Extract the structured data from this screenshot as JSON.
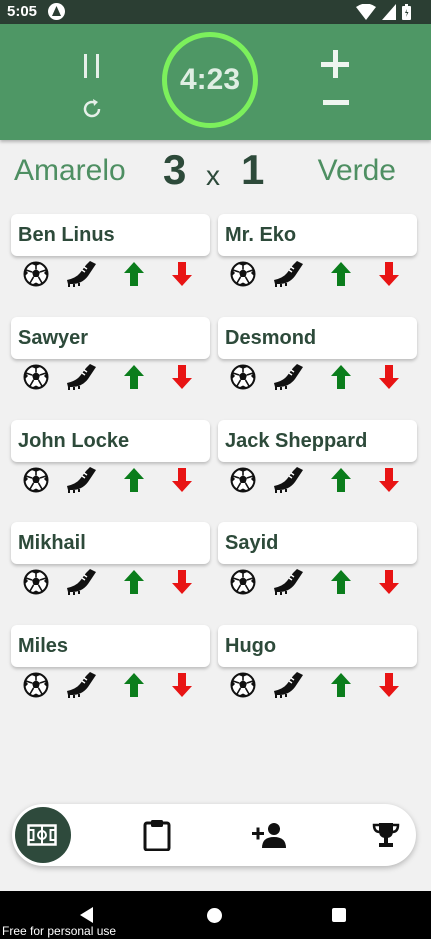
{
  "status_bar": {
    "time": "5:05"
  },
  "header": {
    "timer": "4:23",
    "colors": {
      "header_bg": "#4e9765",
      "timer_ring": "#7cf05c"
    }
  },
  "score": {
    "team_left": "Amarelo",
    "team_right": "Verde",
    "score_left": "3",
    "separator": "x",
    "score_right": "1"
  },
  "players": [
    {
      "name": "Ben Linus"
    },
    {
      "name": "Mr. Eko"
    },
    {
      "name": "Sawyer"
    },
    {
      "name": "Desmond"
    },
    {
      "name": "John Locke"
    },
    {
      "name": "Jack Sheppard"
    },
    {
      "name": "Mikhail"
    },
    {
      "name": "Sayid"
    },
    {
      "name": "Miles"
    },
    {
      "name": "Hugo"
    }
  ],
  "player_actions": [
    "soccer-ball-icon",
    "soccer-cleat-icon",
    "arrow-up-icon",
    "arrow-down-icon"
  ],
  "nav": {
    "items": [
      "field-icon",
      "clipboard-icon",
      "add-person-icon",
      "trophy-icon"
    ],
    "active": "field-icon"
  },
  "watermark": "Free for personal use"
}
